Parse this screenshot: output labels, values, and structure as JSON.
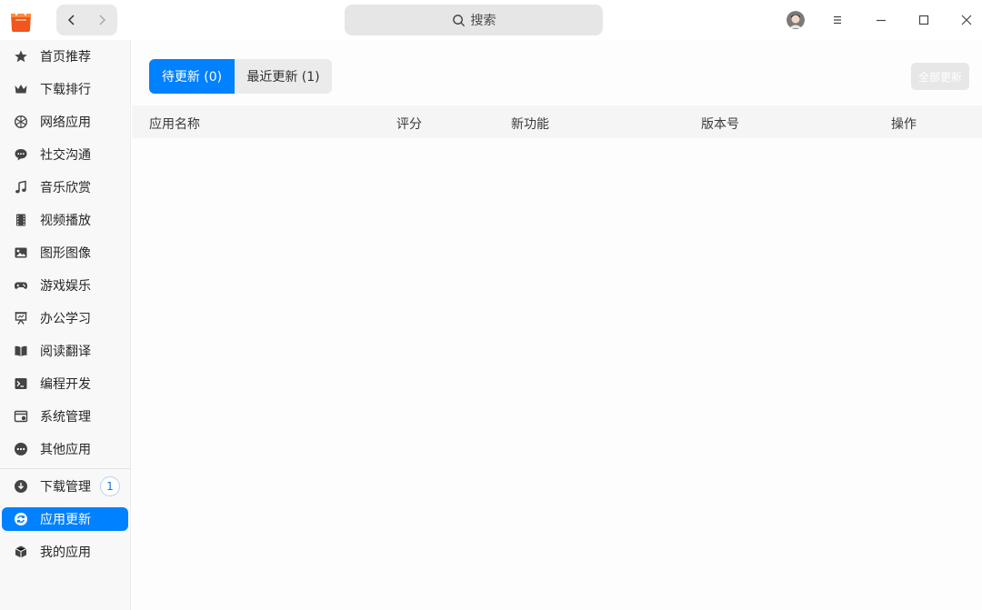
{
  "search": {
    "label": "搜索"
  },
  "sidebar": {
    "items": [
      {
        "label": "首页推荐",
        "icon": "star-icon"
      },
      {
        "label": "下载排行",
        "icon": "crown-icon"
      },
      {
        "label": "网络应用",
        "icon": "globe-icon"
      },
      {
        "label": "社交沟通",
        "icon": "chat-icon"
      },
      {
        "label": "音乐欣赏",
        "icon": "music-note-icon"
      },
      {
        "label": "视频播放",
        "icon": "film-icon"
      },
      {
        "label": "图形图像",
        "icon": "image-icon"
      },
      {
        "label": "游戏娱乐",
        "icon": "gamepad-icon"
      },
      {
        "label": "办公学习",
        "icon": "presentation-icon"
      },
      {
        "label": "阅读翻译",
        "icon": "book-icon"
      },
      {
        "label": "编程开发",
        "icon": "terminal-icon"
      },
      {
        "label": "系统管理",
        "icon": "system-window-icon"
      },
      {
        "label": "其他应用",
        "icon": "more-dots-icon"
      }
    ],
    "bottom_items": [
      {
        "label": "下载管理",
        "icon": "download-icon",
        "badge": "1"
      },
      {
        "label": "应用更新",
        "icon": "refresh-icon",
        "active": true
      },
      {
        "label": "我的应用",
        "icon": "cube-icon"
      }
    ]
  },
  "main": {
    "tabs": [
      {
        "label": "待更新 (0)",
        "active": true
      },
      {
        "label": "最近更新 (1)",
        "active": false
      }
    ],
    "update_all_label": "全部更新",
    "table_headers": [
      "应用名称",
      "评分",
      "新功能",
      "版本号",
      "操作"
    ]
  },
  "colors": {
    "accent": "#0081ff",
    "logo": "#f0561e"
  }
}
